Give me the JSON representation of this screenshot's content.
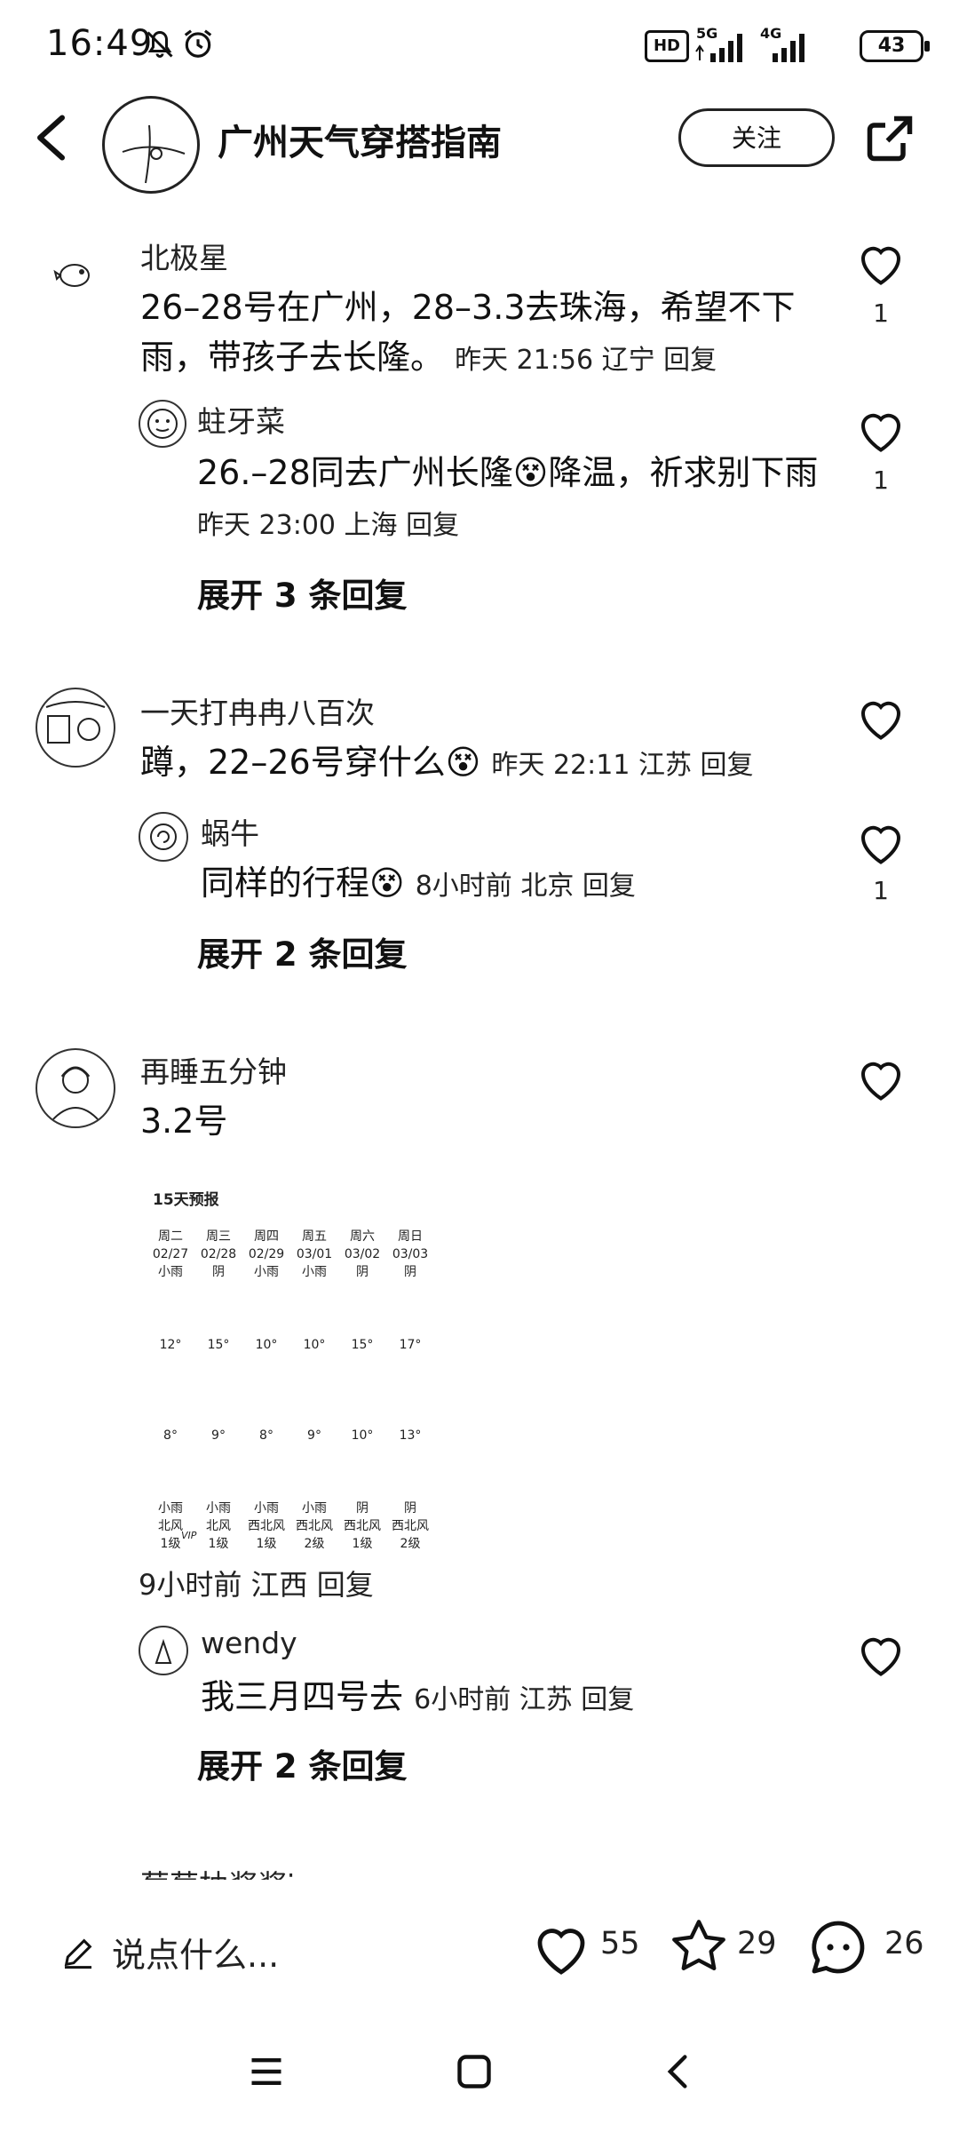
{
  "status_bar": {
    "time": "16:49",
    "signal1": "5G",
    "signal2": "4G",
    "battery": "43",
    "hd": "HD"
  },
  "header": {
    "title": "广州天气穿搭指南",
    "follow_label": "关注"
  },
  "comments": [
    {
      "name": "北极星",
      "text": "26–28号在广州，28–3.3去珠海，希望不下雨，带孩子去长隆。",
      "meta": "昨天 21:56 辽宁 回复",
      "likes": "1",
      "replies": [
        {
          "name": "蛀牙菜",
          "text": "26.–28同去广州长隆😵降温，祈求别下雨",
          "meta": "昨天 23:00 上海 回复",
          "likes": "1"
        }
      ],
      "expand": "展开 3 条回复"
    },
    {
      "name": "一天打冉冉八百次",
      "text": "蹲，22–26号穿什么😵",
      "meta": "昨天 22:11 江苏 回复",
      "likes": "",
      "replies": [
        {
          "name": "蜗牛",
          "text": "同样的行程😵",
          "meta": "8小时前 北京 回复",
          "likes": "1"
        }
      ],
      "expand": "展开 2 条回复"
    },
    {
      "name": "再睡五分钟",
      "text": "3.2号",
      "meta": "9小时前 江西 回复",
      "likes": "",
      "replies": [
        {
          "name": "wendy",
          "text": "我三月四号去",
          "meta": "6小时前 江苏 回复",
          "likes": ""
        }
      ],
      "expand": "展开 2 条回复"
    },
    {
      "name": "葡萄柚酱酱i"
    }
  ],
  "forecast": {
    "title": "15天预报",
    "days": [
      {
        "day": "周二",
        "date": "02/27",
        "weather": "小雨",
        "high": "12°",
        "low": "8°",
        "weather2": "小雨",
        "wind": "北风",
        "level": "1级"
      },
      {
        "day": "周三",
        "date": "02/28",
        "weather": "阴",
        "high": "15°",
        "low": "9°",
        "weather2": "小雨",
        "wind": "北风",
        "level": "1级"
      },
      {
        "day": "周四",
        "date": "02/29",
        "weather": "小雨",
        "high": "10°",
        "low": "8°",
        "weather2": "小雨",
        "wind": "西北风",
        "level": "1级"
      },
      {
        "day": "周五",
        "date": "03/01",
        "weather": "小雨",
        "high": "10°",
        "low": "9°",
        "weather2": "小雨",
        "wind": "西北风",
        "level": "2级"
      },
      {
        "day": "周六",
        "date": "03/02",
        "weather": "阴",
        "high": "15°",
        "low": "10°",
        "weather2": "阴",
        "wind": "西北风",
        "level": "1级"
      },
      {
        "day": "周日",
        "date": "03/03",
        "weather": "阴",
        "high": "17°",
        "low": "13°",
        "weather2": "阴",
        "wind": "西北风",
        "level": "2级"
      }
    ],
    "vip": "VIP"
  },
  "bottom": {
    "input_hint": "说点什么...",
    "likes": "55",
    "stars": "29",
    "comments": "26"
  }
}
